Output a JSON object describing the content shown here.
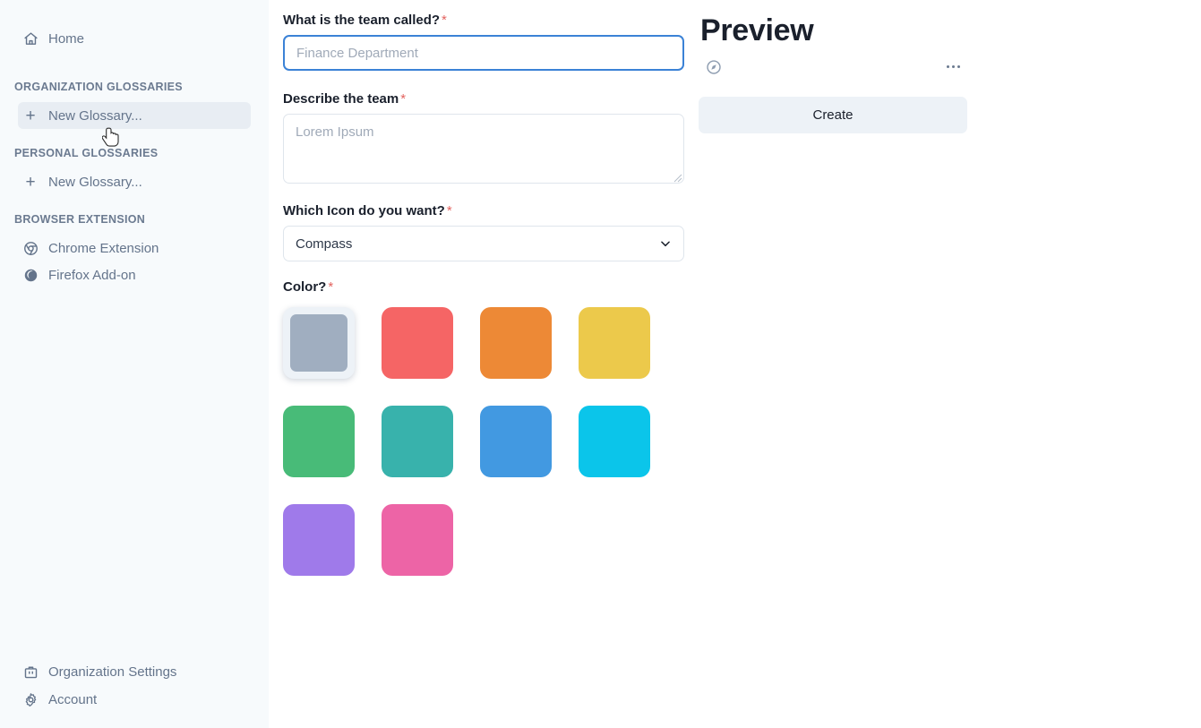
{
  "sidebar": {
    "home": {
      "label": "Home",
      "icon": "home-icon"
    },
    "sections": [
      {
        "heading": "ORGANIZATION GLOSSARIES",
        "items": [
          {
            "label": "New Glossary...",
            "icon": "plus-icon",
            "hovered": true
          }
        ]
      },
      {
        "heading": "PERSONAL GLOSSARIES",
        "items": [
          {
            "label": "New Glossary...",
            "icon": "plus-icon",
            "hovered": false
          }
        ]
      },
      {
        "heading": "BROWSER EXTENSION",
        "items": [
          {
            "label": "Chrome Extension",
            "icon": "chrome-icon",
            "hovered": false
          },
          {
            "label": "Firefox Add-on",
            "icon": "firefox-icon",
            "hovered": false
          }
        ]
      }
    ],
    "bottom_items": [
      {
        "label": "Organization Settings",
        "icon": "briefcase-icon"
      },
      {
        "label": "Account",
        "icon": "gear-icon"
      }
    ],
    "background_color": "#F7FAFC",
    "text_color": "#64748B"
  },
  "form": {
    "name_field": {
      "label": "What is the team called?",
      "required_marker": "*",
      "value": "",
      "placeholder": "Finance Department",
      "focused": true
    },
    "description_field": {
      "label": "Describe the team",
      "required_marker": "*",
      "value": "",
      "placeholder": "Lorem Ipsum"
    },
    "icon_field": {
      "label": "Which Icon do you want?",
      "required_marker": "*",
      "selected": "Compass",
      "options": [
        "Compass"
      ]
    },
    "color_field": {
      "label": "Color?",
      "required_marker": "*",
      "selected_index": 0,
      "swatches": [
        {
          "name": "gray",
          "hex": "#A0AEC0"
        },
        {
          "name": "red",
          "hex": "#F56565"
        },
        {
          "name": "orange",
          "hex": "#ED8936"
        },
        {
          "name": "yellow",
          "hex": "#ECC94B"
        },
        {
          "name": "green",
          "hex": "#48BB78"
        },
        {
          "name": "teal",
          "hex": "#38B2AC"
        },
        {
          "name": "blue",
          "hex": "#4299E1"
        },
        {
          "name": "cyan",
          "hex": "#0BC5EA"
        },
        {
          "name": "purple",
          "hex": "#9F7AEA"
        },
        {
          "name": "pink",
          "hex": "#ED64A6"
        }
      ]
    }
  },
  "preview": {
    "title": "Preview",
    "item_icon": "compass-icon",
    "overflow_menu": "...",
    "create_label": "Create",
    "create_bg": "#EDF2F7"
  },
  "cursor": {
    "type": "pointing-hand-cursor"
  }
}
